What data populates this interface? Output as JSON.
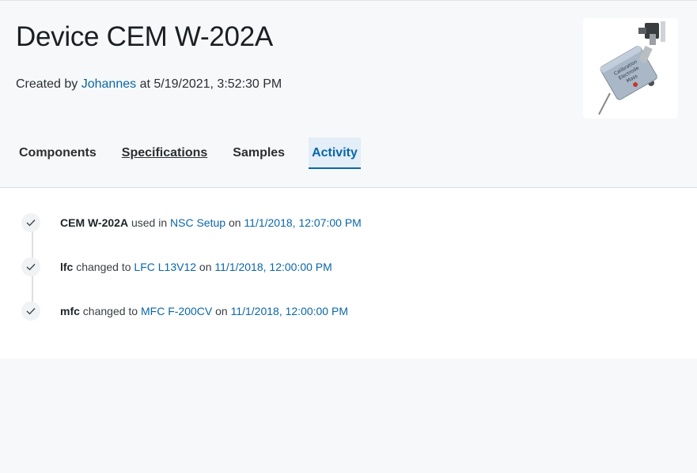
{
  "device": {
    "title": "Device CEM W-202A",
    "created_prefix": "Created by",
    "created_by": "Johannes",
    "created_mid": "at",
    "created_at": "5/19/2021, 3:52:30 PM",
    "image_icon": "device-photo"
  },
  "tabs": [
    {
      "label": "Components"
    },
    {
      "label": "Specifications"
    },
    {
      "label": "Samples"
    },
    {
      "label": "Activity",
      "active": true
    }
  ],
  "activity": [
    {
      "subject": "CEM W-202A",
      "verb": "used in",
      "target": "NSC Setup",
      "on": "on",
      "timestamp": "11/1/2018, 12:07:00 PM"
    },
    {
      "subject": "lfc",
      "verb": "changed to",
      "target": "LFC L13V12",
      "on": "on",
      "timestamp": "11/1/2018, 12:00:00 PM"
    },
    {
      "subject": "mfc",
      "verb": "changed to",
      "target": "MFC F-200CV",
      "on": "on",
      "timestamp": "11/1/2018, 12:00:00 PM"
    }
  ],
  "colors": {
    "link": "#0a66a8",
    "active_tab_bg": "#e3eef8"
  }
}
